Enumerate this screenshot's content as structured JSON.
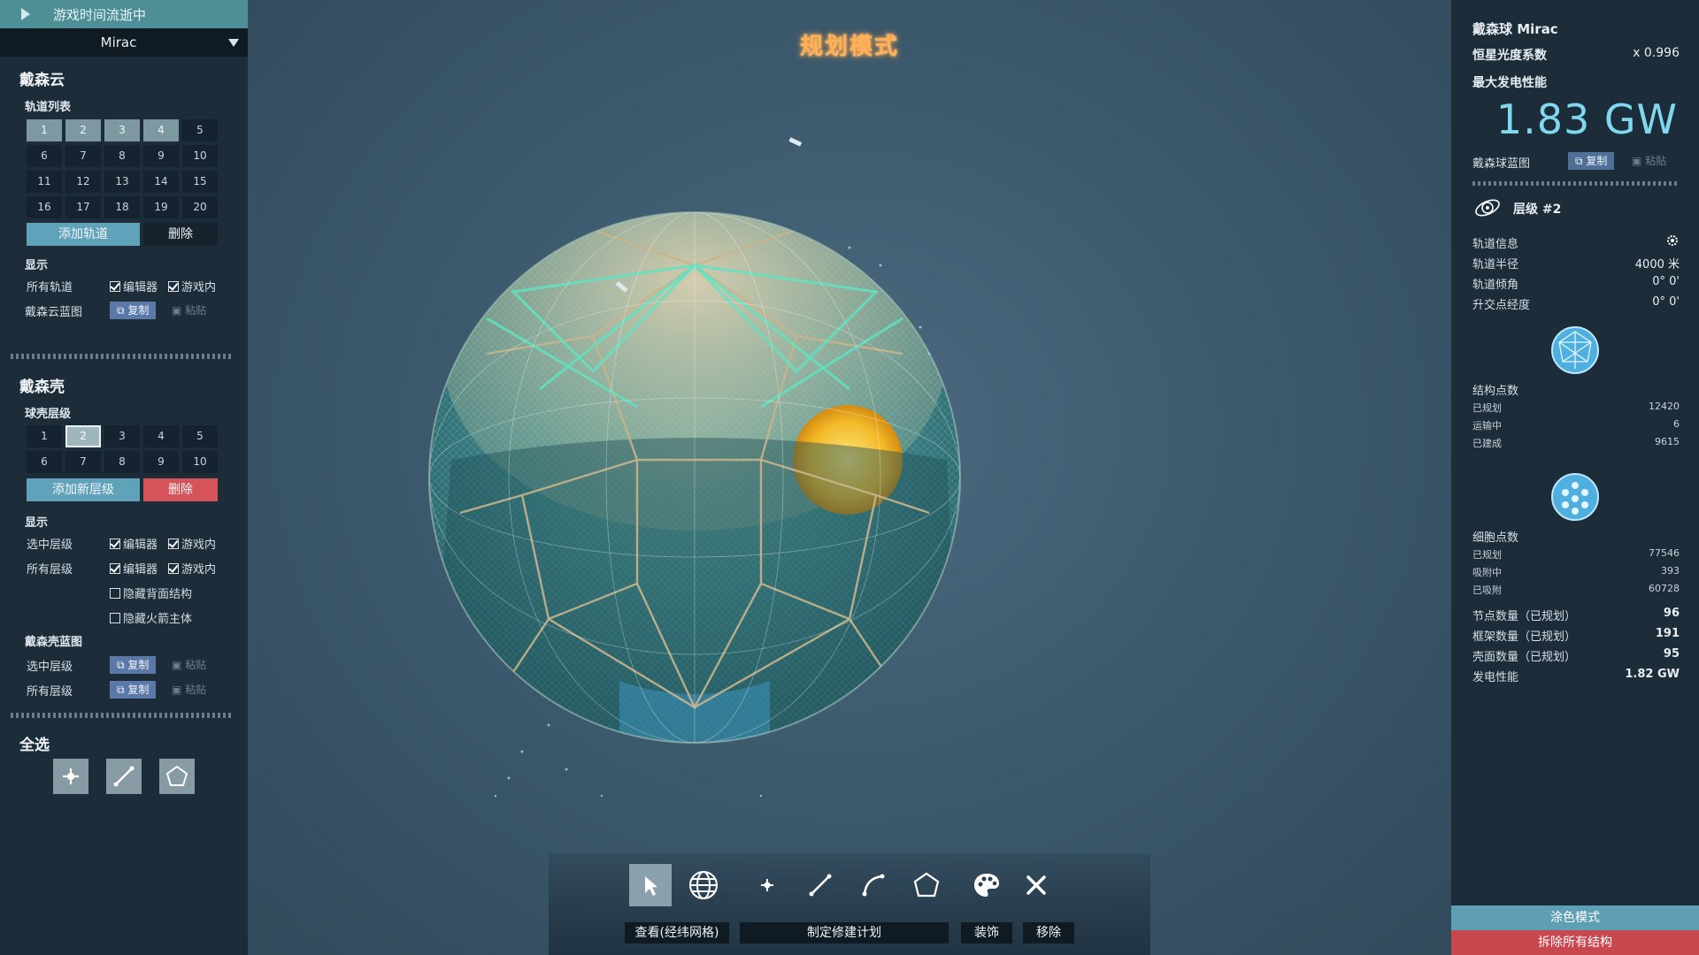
{
  "top_status": "游戏时间流逝中",
  "star_selector": "Mirac",
  "mode_title": "规划模式",
  "dyson_cloud": {
    "title": "戴森云",
    "orbit_list_label": "轨道列表",
    "orbits": [
      "1",
      "2",
      "3",
      "4",
      "5",
      "6",
      "7",
      "8",
      "9",
      "10",
      "11",
      "12",
      "13",
      "14",
      "15",
      "16",
      "17",
      "18",
      "19",
      "20"
    ],
    "add_button": "添加轨道",
    "delete_button": "删除",
    "display_label": "显示",
    "all_orbits_label": "所有轨道",
    "editor_label": "编辑器",
    "ingame_label": "游戏内",
    "blueprint_label": "戴森云蓝图",
    "copy_label": "复制",
    "paste_label": "粘贴"
  },
  "dyson_shell": {
    "title": "戴森壳",
    "layer_label": "球壳层级",
    "layers": [
      "1",
      "2",
      "3",
      "4",
      "5",
      "6",
      "7",
      "8",
      "9",
      "10"
    ],
    "add_button": "添加新层级",
    "delete_button": "删除",
    "display_label": "显示",
    "selected_layer_label": "选中层级",
    "all_layers_label": "所有层级",
    "editor_label": "编辑器",
    "ingame_label": "游戏内",
    "hide_back_label": "隐藏背面结构",
    "hide_rocket_label": "隐藏火箭主体",
    "blueprint_label": "戴森壳蓝图",
    "bp_selected_label": "选中层级",
    "bp_all_label": "所有层级",
    "copy_label": "复制",
    "paste_label": "粘贴"
  },
  "select_all": {
    "title": "全选",
    "tools": [
      "move-node-icon",
      "draw-frame-icon",
      "draw-shell-icon"
    ]
  },
  "right_panel": {
    "sphere_name": "戴森球 Mirac",
    "luminosity_label": "恒星光度系数",
    "luminosity_value": "x 0.996",
    "max_power_label": "最大发电性能",
    "max_power_value": "1.83 GW",
    "blueprint_label": "戴森球蓝图",
    "copy_label": "复制",
    "paste_label": "粘贴",
    "layer_title": "层级 #2",
    "orbit_info_label": "轨道信息",
    "orbit_radius_label": "轨道半径",
    "orbit_radius_value": "4000 米",
    "orbit_incl_label": "轨道倾角",
    "orbit_incl_value": "0° 0'",
    "asc_node_label": "升交点经度",
    "asc_node_value": "0° 0'",
    "struct_points_label": "结构点数",
    "struct_planned_label": "已规划",
    "struct_planned_value": "12420",
    "struct_transit_label": "运输中",
    "struct_transit_value": "6",
    "struct_built_label": "已建成",
    "struct_built_value": "9615",
    "cell_points_label": "细胞点数",
    "cell_planned_label": "已规划",
    "cell_planned_value": "77546",
    "cell_absorbing_label": "吸附中",
    "cell_absorbing_value": "393",
    "cell_absorbed_label": "已吸附",
    "cell_absorbed_value": "60728",
    "nodes_label": "节点数量（已规划）",
    "nodes_value": "96",
    "frames_label": "框架数量（已规划）",
    "frames_value": "191",
    "shells_label": "壳面数量（已规划）",
    "shells_value": "95",
    "power_label": "发电性能",
    "power_value": "1.82 GW",
    "paint_mode": "涂色模式",
    "demolish_all": "拆除所有结构"
  },
  "toolbar": {
    "view_label": "查看(经纬网格)",
    "plan_label": "制定修建计划",
    "decorate_label": "装饰",
    "remove_label": "移除"
  },
  "colors": {
    "panel_bg": "#1c2c39",
    "accent_teal": "#5fa2ba",
    "danger_red": "#d4545a",
    "title_orange": "#ffb15a",
    "power_cyan": "#7fd8ef"
  }
}
